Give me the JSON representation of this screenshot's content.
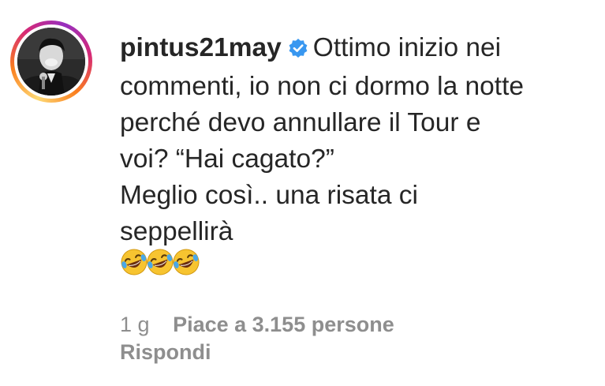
{
  "comment": {
    "username": "pintus21may",
    "verified": true,
    "verified_icon": "verified-badge-icon",
    "avatar_icon": "profile-photo",
    "text_lines": [
      "Ottimo inizio nei",
      "commenti, io non ci dormo la notte",
      "perché devo annullare il Tour e",
      "voi? “Hai cagato?”",
      "Meglio così.. una risata ci",
      "seppellirà"
    ],
    "emojis": [
      "🤣",
      "🤣",
      "🤣"
    ],
    "time": "1 g",
    "likes": "Piace a 3.155 persone",
    "reply": "Rispondi"
  },
  "colors": {
    "text": "#262626",
    "secondary": "#8e8e8e",
    "verified": "#3897f0"
  }
}
